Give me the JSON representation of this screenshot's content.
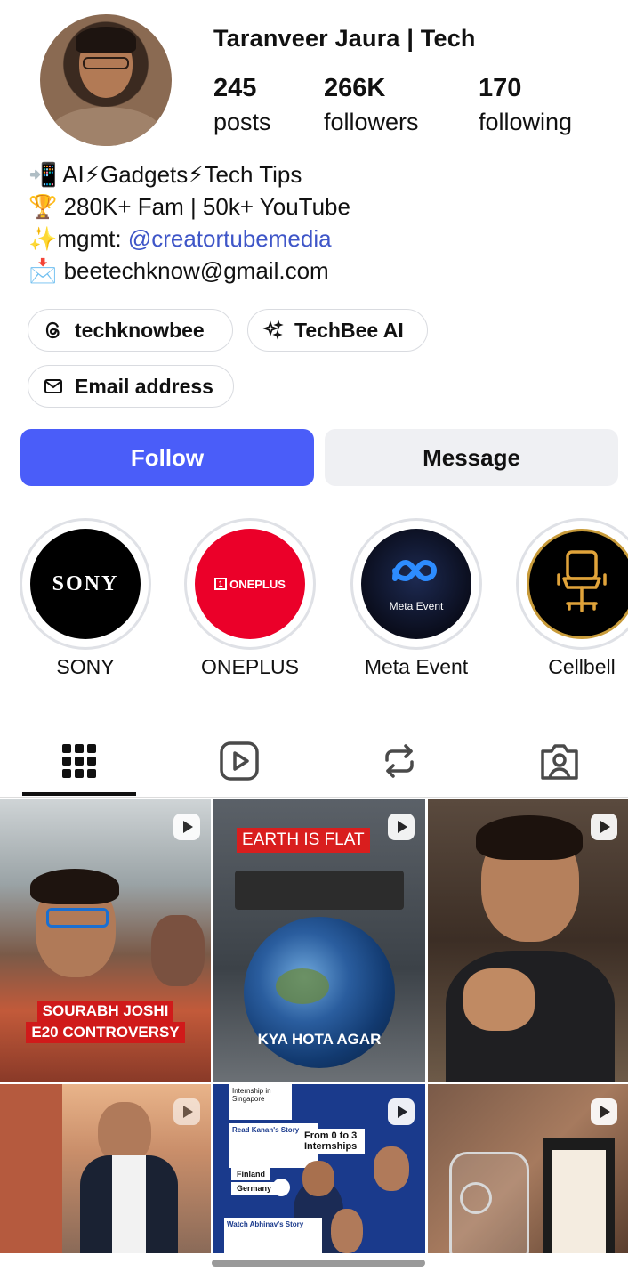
{
  "profile": {
    "name": "Taranveer Jaura | Tech",
    "stats": [
      {
        "value": "245",
        "label": "posts"
      },
      {
        "value": "266K",
        "label": "followers"
      },
      {
        "value": "170",
        "label": "following"
      }
    ]
  },
  "bio": {
    "line1": "📲 AI⚡Gadgets⚡Tech Tips",
    "line2": "🏆 280K+ Fam | 50k+ YouTube",
    "line3_prefix": "✨mgmt: ",
    "line3_link": "@creatortubemedia",
    "line4": "📩 beetechknow@gmail.com"
  },
  "chips": {
    "threads": "techknowbee",
    "ai": "TechBee AI",
    "email": "Email address"
  },
  "actions": {
    "follow": "Follow",
    "message": "Message"
  },
  "highlights": [
    {
      "label": "SONY",
      "cover_text": "SONY"
    },
    {
      "label": "ONEPLUS",
      "cover_text": "ONEPLUS"
    },
    {
      "label": "Meta Event",
      "cover_text": "Meta Event"
    },
    {
      "label": "Cellbell",
      "cover_text": ""
    }
  ],
  "tabs": [
    "grid-icon",
    "reels-icon",
    "reposts-icon",
    "tagged-icon"
  ],
  "posts": {
    "p1": {
      "caption1": "SOURABH JOSHI",
      "caption2": "E20 CONTROVERSY"
    },
    "p2": {
      "caption_top": "EARTH IS FLAT",
      "caption_bottom": "KYA HOTA AGAR"
    },
    "p3": {},
    "p4": {},
    "p5": {
      "heading": "Internship in Singapore",
      "read": "Read Kanan's Story",
      "big": "From 0 to 3 Internships",
      "countries": [
        "Finland",
        "Germany"
      ],
      "watch": "Watch Abhinav's Story"
    },
    "p6": {}
  },
  "colors": {
    "accent": "#4a5df9",
    "link": "#3f56c8",
    "oneplus": "#eb0029"
  }
}
